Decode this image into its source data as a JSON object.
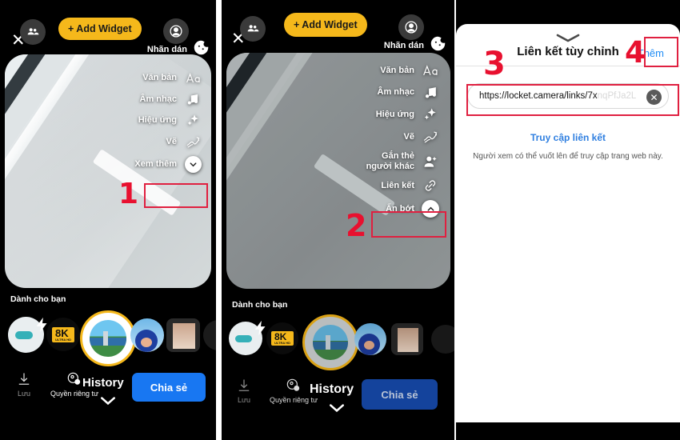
{
  "panels": [
    {
      "id": "panel-1",
      "toolbar": {
        "add_widget": "+ Add Widget",
        "close_icon": "close-icon",
        "friends_icon": "friends-icon",
        "profile_icon": "profile-icon"
      },
      "sticker": {
        "label": "Nhãn dán",
        "icon": "sticker-icon"
      },
      "menu": [
        {
          "label": "Văn bản",
          "icon": "text-aa-icon"
        },
        {
          "label": "Âm nhạc",
          "icon": "music-note-icon"
        },
        {
          "label": "Hiệu ứng",
          "icon": "sparkles-icon"
        },
        {
          "label": "Vẽ",
          "icon": "scribble-icon"
        },
        {
          "label": "Xem thêm",
          "icon": "chevron-down-circle-icon"
        }
      ],
      "foryou_title": "Dành cho bạn",
      "actions": {
        "save": "Lưu",
        "privacy": "Quyền riêng tư",
        "history": "History",
        "share": "Chia sẻ"
      }
    },
    {
      "id": "panel-2",
      "toolbar": {
        "add_widget": "+ Add Widget",
        "close_icon": "close-icon",
        "friends_icon": "friends-icon",
        "profile_icon": "profile-icon"
      },
      "sticker": {
        "label": "Nhãn dán",
        "icon": "sticker-icon"
      },
      "menu": [
        {
          "label": "Văn bản",
          "icon": "text-aa-icon"
        },
        {
          "label": "Âm nhạc",
          "icon": "music-note-icon"
        },
        {
          "label": "Hiệu ứng",
          "icon": "sparkles-icon"
        },
        {
          "label": "Vẽ",
          "icon": "scribble-icon"
        },
        {
          "label": "Gắn thẻ người khác",
          "icon": "tag-person-icon"
        },
        {
          "label": "Liên kết",
          "icon": "link-chain-icon"
        },
        {
          "label": "Ẩn bớt",
          "icon": "chevron-up-circle-icon"
        }
      ],
      "foryou_title": "Dành cho bạn",
      "actions": {
        "save": "Lưu",
        "privacy": "Quyền riêng tư",
        "history": "History",
        "share": "Chia sẻ"
      }
    }
  ],
  "sheet": {
    "title": "Liên kết tùy chỉnh",
    "add_button": "Thêm",
    "grabber_icon": "chevron-down-grabber-icon",
    "url_value": "https://locket.camera/links/7x",
    "url_ghost": "nqPfJa2L",
    "clear_icon": "clear-circle-icon",
    "visit_link": "Truy cập liên kết",
    "helper_text": "Người xem có thể vuốt lên để truy cập trang web này."
  },
  "annotations": [
    {
      "number": "1",
      "target": "xem-them-menu-item"
    },
    {
      "number": "2",
      "target": "lien-ket-menu-item"
    },
    {
      "number": "3",
      "target": "url-input-field"
    },
    {
      "number": "4",
      "target": "them-button"
    }
  ],
  "colors": {
    "accent_yellow": "#f5b81b",
    "share_blue": "#1877f2",
    "link_blue": "#2f7fe0",
    "annotation_red": "#e8102f"
  }
}
